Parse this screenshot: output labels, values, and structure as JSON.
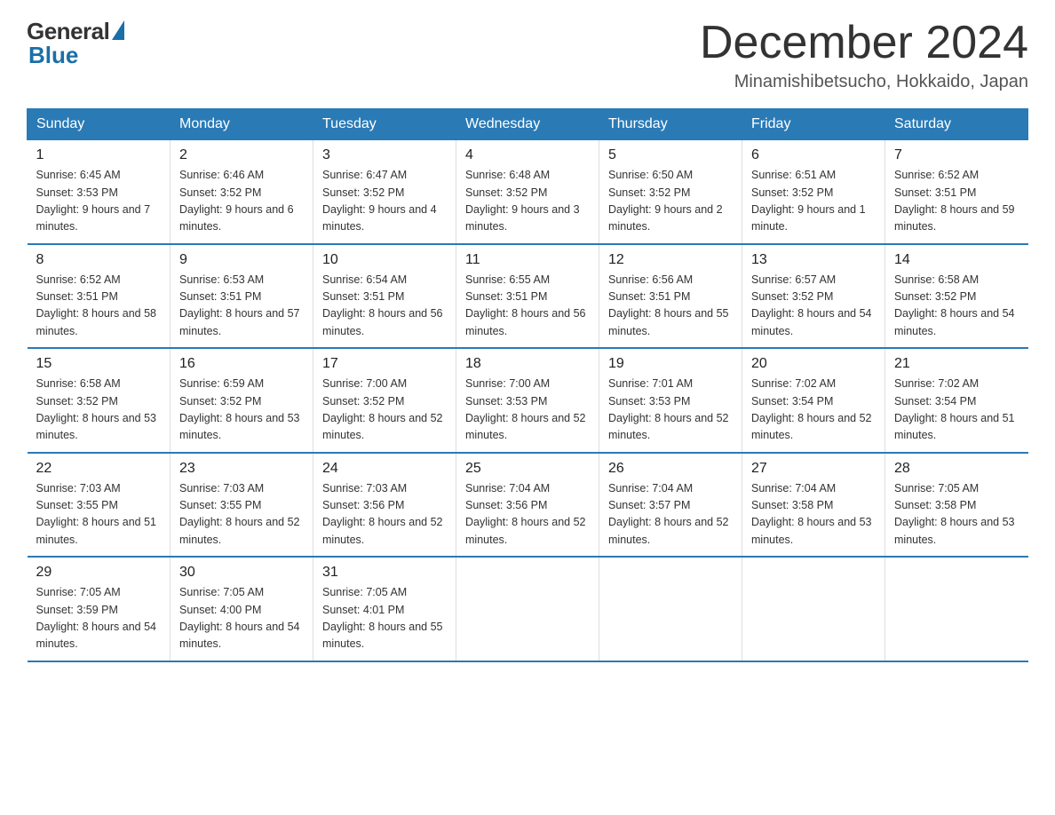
{
  "logo": {
    "general": "General",
    "blue": "Blue"
  },
  "title": "December 2024",
  "location": "Minamishibetsucho, Hokkaido, Japan",
  "days_of_week": [
    "Sunday",
    "Monday",
    "Tuesday",
    "Wednesday",
    "Thursday",
    "Friday",
    "Saturday"
  ],
  "weeks": [
    [
      {
        "day": "1",
        "sunrise": "6:45 AM",
        "sunset": "3:53 PM",
        "daylight": "9 hours and 7 minutes."
      },
      {
        "day": "2",
        "sunrise": "6:46 AM",
        "sunset": "3:52 PM",
        "daylight": "9 hours and 6 minutes."
      },
      {
        "day": "3",
        "sunrise": "6:47 AM",
        "sunset": "3:52 PM",
        "daylight": "9 hours and 4 minutes."
      },
      {
        "day": "4",
        "sunrise": "6:48 AM",
        "sunset": "3:52 PM",
        "daylight": "9 hours and 3 minutes."
      },
      {
        "day": "5",
        "sunrise": "6:50 AM",
        "sunset": "3:52 PM",
        "daylight": "9 hours and 2 minutes."
      },
      {
        "day": "6",
        "sunrise": "6:51 AM",
        "sunset": "3:52 PM",
        "daylight": "9 hours and 1 minute."
      },
      {
        "day": "7",
        "sunrise": "6:52 AM",
        "sunset": "3:51 PM",
        "daylight": "8 hours and 59 minutes."
      }
    ],
    [
      {
        "day": "8",
        "sunrise": "6:52 AM",
        "sunset": "3:51 PM",
        "daylight": "8 hours and 58 minutes."
      },
      {
        "day": "9",
        "sunrise": "6:53 AM",
        "sunset": "3:51 PM",
        "daylight": "8 hours and 57 minutes."
      },
      {
        "day": "10",
        "sunrise": "6:54 AM",
        "sunset": "3:51 PM",
        "daylight": "8 hours and 56 minutes."
      },
      {
        "day": "11",
        "sunrise": "6:55 AM",
        "sunset": "3:51 PM",
        "daylight": "8 hours and 56 minutes."
      },
      {
        "day": "12",
        "sunrise": "6:56 AM",
        "sunset": "3:51 PM",
        "daylight": "8 hours and 55 minutes."
      },
      {
        "day": "13",
        "sunrise": "6:57 AM",
        "sunset": "3:52 PM",
        "daylight": "8 hours and 54 minutes."
      },
      {
        "day": "14",
        "sunrise": "6:58 AM",
        "sunset": "3:52 PM",
        "daylight": "8 hours and 54 minutes."
      }
    ],
    [
      {
        "day": "15",
        "sunrise": "6:58 AM",
        "sunset": "3:52 PM",
        "daylight": "8 hours and 53 minutes."
      },
      {
        "day": "16",
        "sunrise": "6:59 AM",
        "sunset": "3:52 PM",
        "daylight": "8 hours and 53 minutes."
      },
      {
        "day": "17",
        "sunrise": "7:00 AM",
        "sunset": "3:52 PM",
        "daylight": "8 hours and 52 minutes."
      },
      {
        "day": "18",
        "sunrise": "7:00 AM",
        "sunset": "3:53 PM",
        "daylight": "8 hours and 52 minutes."
      },
      {
        "day": "19",
        "sunrise": "7:01 AM",
        "sunset": "3:53 PM",
        "daylight": "8 hours and 52 minutes."
      },
      {
        "day": "20",
        "sunrise": "7:02 AM",
        "sunset": "3:54 PM",
        "daylight": "8 hours and 52 minutes."
      },
      {
        "day": "21",
        "sunrise": "7:02 AM",
        "sunset": "3:54 PM",
        "daylight": "8 hours and 51 minutes."
      }
    ],
    [
      {
        "day": "22",
        "sunrise": "7:03 AM",
        "sunset": "3:55 PM",
        "daylight": "8 hours and 51 minutes."
      },
      {
        "day": "23",
        "sunrise": "7:03 AM",
        "sunset": "3:55 PM",
        "daylight": "8 hours and 52 minutes."
      },
      {
        "day": "24",
        "sunrise": "7:03 AM",
        "sunset": "3:56 PM",
        "daylight": "8 hours and 52 minutes."
      },
      {
        "day": "25",
        "sunrise": "7:04 AM",
        "sunset": "3:56 PM",
        "daylight": "8 hours and 52 minutes."
      },
      {
        "day": "26",
        "sunrise": "7:04 AM",
        "sunset": "3:57 PM",
        "daylight": "8 hours and 52 minutes."
      },
      {
        "day": "27",
        "sunrise": "7:04 AM",
        "sunset": "3:58 PM",
        "daylight": "8 hours and 53 minutes."
      },
      {
        "day": "28",
        "sunrise": "7:05 AM",
        "sunset": "3:58 PM",
        "daylight": "8 hours and 53 minutes."
      }
    ],
    [
      {
        "day": "29",
        "sunrise": "7:05 AM",
        "sunset": "3:59 PM",
        "daylight": "8 hours and 54 minutes."
      },
      {
        "day": "30",
        "sunrise": "7:05 AM",
        "sunset": "4:00 PM",
        "daylight": "8 hours and 54 minutes."
      },
      {
        "day": "31",
        "sunrise": "7:05 AM",
        "sunset": "4:01 PM",
        "daylight": "8 hours and 55 minutes."
      },
      null,
      null,
      null,
      null
    ]
  ]
}
